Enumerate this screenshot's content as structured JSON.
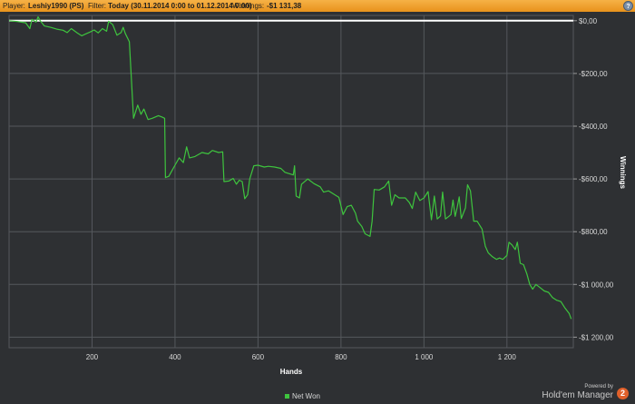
{
  "header": {
    "player_label": "Player:",
    "player_value": "Leshiy1990 (PS)",
    "filter_label": "Filter:",
    "filter_value": "Today (30.11.2014 0:00 to 01.12.2014 0:00)",
    "winnings_label": "Winnings:",
    "winnings_value": "-$1 131,38",
    "help_icon": "help-icon",
    "help_glyph": "?"
  },
  "branding": {
    "powered_by": "Powered by",
    "name": "Hold'em Manager",
    "logo_glyph": "2"
  },
  "colors": {
    "background": "#2e3033",
    "grid": "#55585d",
    "series": "#3ec43e",
    "zero_line": "#ffffff",
    "titlebar": "#f0a030"
  },
  "chart_data": {
    "type": "line",
    "xlabel": "Hands",
    "ylabel": "Winnings",
    "xlim": [
      0,
      1360
    ],
    "ylim": [
      -1240,
      20
    ],
    "x_ticks": [
      200,
      400,
      600,
      800,
      1000,
      1200
    ],
    "x_tick_labels": [
      "200",
      "400",
      "600",
      "800",
      "1 000",
      "1 200"
    ],
    "y_ticks": [
      0,
      -200,
      -400,
      -600,
      -800,
      -1000,
      -1200
    ],
    "y_tick_labels": [
      "$0,00",
      "-$200,00",
      "-$400,00",
      "-$600,00",
      "-$800,00",
      "-$1 000,00",
      "-$1 200,00"
    ],
    "grid": true,
    "legend_position": "bottom",
    "series": [
      {
        "name": "Net Won",
        "points": [
          [
            0,
            0
          ],
          [
            20,
            -3
          ],
          [
            40,
            -8
          ],
          [
            50,
            -30
          ],
          [
            55,
            5
          ],
          [
            65,
            -5
          ],
          [
            70,
            15
          ],
          [
            75,
            0
          ],
          [
            85,
            -20
          ],
          [
            100,
            -25
          ],
          [
            115,
            -32
          ],
          [
            130,
            -36
          ],
          [
            140,
            -45
          ],
          [
            150,
            -30
          ],
          [
            165,
            -47
          ],
          [
            175,
            -57
          ],
          [
            185,
            -50
          ],
          [
            195,
            -43
          ],
          [
            205,
            -35
          ],
          [
            215,
            -46
          ],
          [
            225,
            -30
          ],
          [
            235,
            -40
          ],
          [
            240,
            -2
          ],
          [
            250,
            -15
          ],
          [
            260,
            -55
          ],
          [
            270,
            -45
          ],
          [
            275,
            -25
          ],
          [
            280,
            -48
          ],
          [
            290,
            -80
          ],
          [
            300,
            -370
          ],
          [
            310,
            -320
          ],
          [
            318,
            -355
          ],
          [
            325,
            -335
          ],
          [
            335,
            -375
          ],
          [
            345,
            -370
          ],
          [
            360,
            -360
          ],
          [
            368,
            -365
          ],
          [
            375,
            -370
          ],
          [
            377,
            -595
          ],
          [
            385,
            -590
          ],
          [
            392,
            -570
          ],
          [
            400,
            -548
          ],
          [
            410,
            -520
          ],
          [
            420,
            -538
          ],
          [
            428,
            -478
          ],
          [
            435,
            -520
          ],
          [
            448,
            -515
          ],
          [
            465,
            -500
          ],
          [
            480,
            -505
          ],
          [
            490,
            -492
          ],
          [
            505,
            -500
          ],
          [
            515,
            -497
          ],
          [
            518,
            -610
          ],
          [
            530,
            -608
          ],
          [
            540,
            -598
          ],
          [
            548,
            -620
          ],
          [
            555,
            -605
          ],
          [
            562,
            -610
          ],
          [
            568,
            -675
          ],
          [
            575,
            -660
          ],
          [
            580,
            -600
          ],
          [
            590,
            -550
          ],
          [
            600,
            -548
          ],
          [
            615,
            -555
          ],
          [
            625,
            -552
          ],
          [
            640,
            -555
          ],
          [
            655,
            -560
          ],
          [
            665,
            -575
          ],
          [
            685,
            -585
          ],
          [
            688,
            -550
          ],
          [
            692,
            -665
          ],
          [
            700,
            -672
          ],
          [
            705,
            -620
          ],
          [
            720,
            -600
          ],
          [
            735,
            -618
          ],
          [
            750,
            -630
          ],
          [
            758,
            -650
          ],
          [
            770,
            -645
          ],
          [
            785,
            -660
          ],
          [
            795,
            -670
          ],
          [
            798,
            -690
          ],
          [
            805,
            -735
          ],
          [
            815,
            -705
          ],
          [
            825,
            -700
          ],
          [
            835,
            -730
          ],
          [
            840,
            -760
          ],
          [
            850,
            -780
          ],
          [
            858,
            -808
          ],
          [
            870,
            -818
          ],
          [
            875,
            -760
          ],
          [
            880,
            -640
          ],
          [
            892,
            -642
          ],
          [
            905,
            -630
          ],
          [
            915,
            -608
          ],
          [
            922,
            -700
          ],
          [
            930,
            -660
          ],
          [
            940,
            -672
          ],
          [
            955,
            -672
          ],
          [
            965,
            -690
          ],
          [
            972,
            -712
          ],
          [
            980,
            -650
          ],
          [
            990,
            -682
          ],
          [
            1000,
            -672
          ],
          [
            1010,
            -648
          ],
          [
            1018,
            -755
          ],
          [
            1025,
            -665
          ],
          [
            1032,
            -752
          ],
          [
            1040,
            -740
          ],
          [
            1045,
            -650
          ],
          [
            1052,
            -752
          ],
          [
            1060,
            -742
          ],
          [
            1065,
            -735
          ],
          [
            1070,
            -680
          ],
          [
            1075,
            -742
          ],
          [
            1080,
            -710
          ],
          [
            1085,
            -668
          ],
          [
            1090,
            -750
          ],
          [
            1100,
            -710
          ],
          [
            1105,
            -622
          ],
          [
            1112,
            -645
          ],
          [
            1120,
            -760
          ],
          [
            1128,
            -760
          ],
          [
            1140,
            -790
          ],
          [
            1148,
            -855
          ],
          [
            1155,
            -880
          ],
          [
            1165,
            -895
          ],
          [
            1175,
            -905
          ],
          [
            1182,
            -900
          ],
          [
            1190,
            -905
          ],
          [
            1200,
            -890
          ],
          [
            1205,
            -840
          ],
          [
            1212,
            -850
          ],
          [
            1220,
            -868
          ],
          [
            1225,
            -840
          ],
          [
            1232,
            -920
          ],
          [
            1240,
            -925
          ],
          [
            1248,
            -960
          ],
          [
            1255,
            -1000
          ],
          [
            1262,
            -1018
          ],
          [
            1270,
            -1000
          ],
          [
            1280,
            -1012
          ],
          [
            1290,
            -1025
          ],
          [
            1300,
            -1030
          ],
          [
            1310,
            -1050
          ],
          [
            1320,
            -1060
          ],
          [
            1330,
            -1065
          ],
          [
            1340,
            -1090
          ],
          [
            1350,
            -1110
          ],
          [
            1355,
            -1131
          ]
        ]
      }
    ]
  }
}
